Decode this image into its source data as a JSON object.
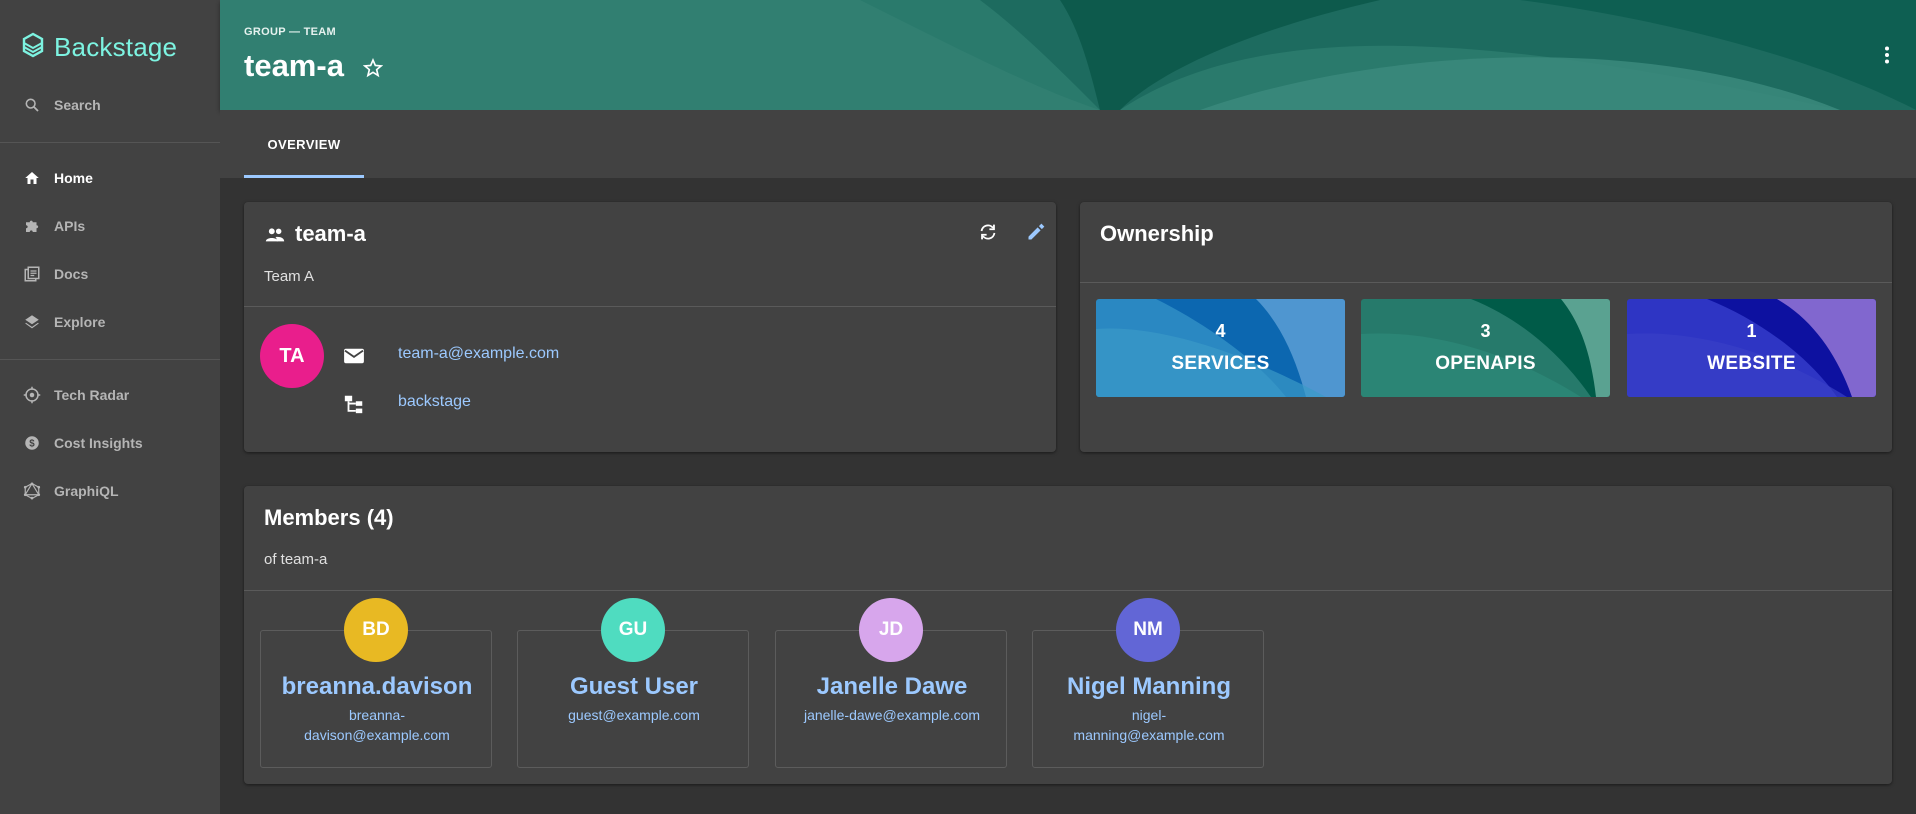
{
  "app": {
    "name": "Backstage"
  },
  "sidebar": {
    "items": [
      {
        "label": "Search",
        "icon": "search-icon"
      },
      {
        "label": "Home",
        "icon": "home-icon",
        "active": true
      },
      {
        "label": "APIs",
        "icon": "puzzle-icon"
      },
      {
        "label": "Docs",
        "icon": "docs-icon"
      },
      {
        "label": "Explore",
        "icon": "layers-icon"
      },
      {
        "label": "Tech Radar",
        "icon": "radar-icon"
      },
      {
        "label": "Cost Insights",
        "icon": "money-icon"
      },
      {
        "label": "GraphiQL",
        "icon": "graphql-icon"
      }
    ]
  },
  "header": {
    "kind": "GROUP — TEAM",
    "title": "team-a"
  },
  "tabs": [
    {
      "label": "OVERVIEW",
      "active": true
    }
  ],
  "group_card": {
    "title": "team-a",
    "description": "Team A",
    "avatar_initials": "TA",
    "email": "team-a@example.com",
    "parent": "backstage"
  },
  "ownership": {
    "title": "Ownership",
    "tiles": [
      {
        "count": "4",
        "label": "SERVICES"
      },
      {
        "count": "3",
        "label": "OPENAPIS"
      },
      {
        "count": "1",
        "label": "WEBSITE"
      }
    ]
  },
  "members": {
    "title": "Members (4)",
    "subtitle": "of team-a",
    "list": [
      {
        "initials": "BD",
        "name": "breanna.davison",
        "email_line1": "breanna-",
        "email_line2": "davison@example.com",
        "color": "#e8b923"
      },
      {
        "initials": "GU",
        "name": "Guest User",
        "email_line1": "guest@example.com",
        "email_line2": "",
        "color": "#4fdcc0"
      },
      {
        "initials": "JD",
        "name": "Janelle Dawe",
        "email_line1": "janelle-dawe@example.com",
        "email_line2": "",
        "color": "#d7a6ec"
      },
      {
        "initials": "NM",
        "name": "Nigel Manning",
        "email_line1": "nigel-",
        "email_line2": "manning@example.com",
        "color": "#6266d6"
      }
    ]
  },
  "colors": {
    "accent": "#7df3e1",
    "link": "#9cc9ff",
    "header": "#1d6b5f",
    "services_tile": "#2a88c2",
    "openapis_tile": "#267a6b",
    "website_tile": "#2e35c4"
  }
}
